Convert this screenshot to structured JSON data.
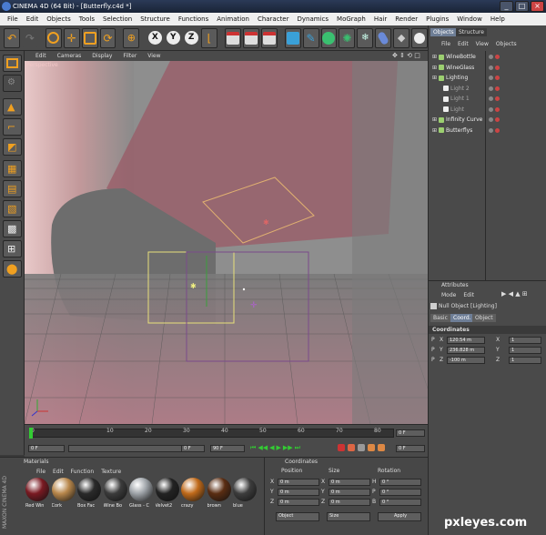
{
  "window": {
    "title": "CINEMA 4D (64 Bit) - [Butterfly.c4d *]",
    "controls": [
      "_",
      "□",
      "×"
    ]
  },
  "menubar": [
    "File",
    "Edit",
    "Objects",
    "Tools",
    "Selection",
    "Structure",
    "Functions",
    "Animation",
    "Character",
    "Dynamics",
    "MoGraph",
    "Hair",
    "Render",
    "Plugins",
    "Window",
    "Help"
  ],
  "toolbar": {
    "axis_x": "X",
    "axis_y": "Y",
    "axis_z": "Z"
  },
  "viewport": {
    "menu": [
      "Edit",
      "Cameras",
      "Display",
      "Filter",
      "View"
    ],
    "label": "Perspective"
  },
  "timeline": {
    "ticks": [
      "0",
      "10",
      "20",
      "30",
      "40",
      "50",
      "60",
      "70",
      "80",
      "90"
    ],
    "end_frame": "0 F",
    "start_field": "0 F",
    "second_field": "0 F",
    "max_field": "90 F",
    "fps_field": "0 F"
  },
  "materials": {
    "menu": [
      "File",
      "Edit",
      "Function",
      "Texture"
    ],
    "header": "Materials",
    "items": [
      {
        "label": "Red Win",
        "color": "#7a1a22"
      },
      {
        "label": "Cork",
        "color": "#b8874b"
      },
      {
        "label": "Box Fac",
        "color": "#2a2a2a"
      },
      {
        "label": "Wine Bo",
        "color": "#3b3b3b"
      },
      {
        "label": "Glass - C",
        "color": "#9ea3a8"
      },
      {
        "label": "Velvet2",
        "color": "#232323"
      },
      {
        "label": "crazy",
        "color": "#c06a1a"
      },
      {
        "label": "brown",
        "color": "#5a2d12"
      },
      {
        "label": "blue",
        "color": "#3d3d3d"
      }
    ]
  },
  "coordinates_panel": {
    "header": "Coordinates",
    "columns": [
      "Position",
      "Size",
      "Rotation"
    ],
    "rows": [
      {
        "axis": "X",
        "pos": "0 m",
        "size_axis": "X",
        "size": "0 m",
        "rot_axis": "H",
        "rot": "0 °"
      },
      {
        "axis": "Y",
        "pos": "0 m",
        "size_axis": "Y",
        "size": "0 m",
        "rot_axis": "P",
        "rot": "0 °"
      },
      {
        "axis": "Z",
        "pos": "0 m",
        "size_axis": "Z",
        "size": "0 m",
        "rot_axis": "B",
        "rot": "0 °"
      }
    ],
    "mode_select": "Object",
    "size_select": "Size",
    "apply_label": "Apply"
  },
  "objects_panel": {
    "tabs": [
      "Objects",
      "Structure"
    ],
    "menu": [
      "File",
      "Edit",
      "View",
      "Objects"
    ],
    "items": [
      {
        "name": "WineBottle",
        "indent": 0,
        "dim": false
      },
      {
        "name": "WineGlass",
        "indent": 0,
        "dim": false
      },
      {
        "name": "Lighting",
        "indent": 0,
        "dim": false
      },
      {
        "name": "Light 2",
        "indent": 1,
        "dim": true
      },
      {
        "name": "Light 1",
        "indent": 1,
        "dim": true
      },
      {
        "name": "Light",
        "indent": 1,
        "dim": true
      },
      {
        "name": "Infinity Curve",
        "indent": 0,
        "dim": false
      },
      {
        "name": "Butterflys",
        "indent": 0,
        "dim": false
      }
    ]
  },
  "attributes_panel": {
    "header": "Attributes",
    "menu": [
      "Mode",
      "Edit"
    ],
    "object_label": "Null Object [Lighting]",
    "tabs": [
      "Basic",
      "Coord.",
      "Object"
    ],
    "section": "Coordinates",
    "rows": [
      {
        "p": "P",
        "axis": "X",
        "value": "120.54 m",
        "s_axis": "X",
        "s": "1"
      },
      {
        "p": "P",
        "axis": "Y",
        "value": "236.828 m",
        "s_axis": "Y",
        "s": "1"
      },
      {
        "p": "P",
        "axis": "Z",
        "value": "-100 m",
        "s_axis": "Z",
        "s": "1"
      }
    ]
  },
  "branding": {
    "maxon": "MAXON CINEMA 4D",
    "watermark": "pxleyes.com"
  }
}
